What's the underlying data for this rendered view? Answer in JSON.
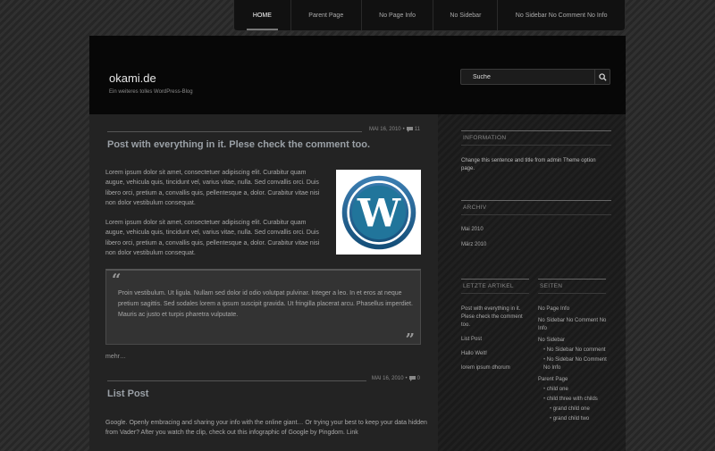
{
  "nav": {
    "home": "HOME",
    "parent_page": "Parent Page",
    "no_page_info": "No Page Info",
    "no_sidebar": "No Sidebar",
    "no_sidebar_no_comment": "No Sidebar No Comment No Info"
  },
  "header": {
    "title": "okami.de",
    "tagline": "Ein weiteres tolles WordPress-Blog"
  },
  "search": {
    "placeholder": "Suche",
    "icon": "search-icon"
  },
  "posts": [
    {
      "date": "MAI 16, 2010",
      "comments": "11",
      "title": "Post with everything in it. Plese check the comment too.",
      "paragraphs": [
        "Lorem ipsum dolor sit amet, consectetuer adipiscing elit. Curabitur quam augue, vehicula quis, tincidunt vel, varius vitae, nulla. Sed convallis orci. Duis libero orci, pretium a, convallis quis, pellentesque a, dolor. Curabitur vitae nisi non dolor vestibulum consequat.",
        "Lorem ipsum dolor sit amet, consectetuer adipiscing elit. Curabitur quam augue, vehicula quis, tincidunt vel, varius vitae, nulla. Sed convallis orci. Duis libero orci, pretium a, convallis quis, pellentesque a, dolor. Curabitur vitae nisi non dolor vestibulum consequat."
      ],
      "quote": "Proin vestibulum. Ut ligula. Nullam sed dolor id odio volutpat pulvinar. Integer a leo. In et eros at neque pretium sagittis. Sed sodales lorem a ipsum suscipit gravida. Ut fringilla placerat arcu. Phasellus imperdiet. Mauris ac justo et turpis pharetra vulputate.",
      "more": "mehr…"
    },
    {
      "date": "MAI 16, 2010",
      "comments": "0",
      "title": "List Post",
      "paragraph": "Google. Openly embracing and sharing your info with the online giant… Or trying your best to keep your data hidden from Vader? After you watch the clip, check out this infographic of Google by Pingdom. Link"
    }
  ],
  "sidebar": {
    "information": {
      "title": "INFORMATION",
      "text": "Change this sentence and title from admin Theme option page."
    },
    "archive": {
      "title": "ARCHIV",
      "items": [
        "Mai 2010",
        "März 2010"
      ]
    },
    "recent": {
      "title": "LETZTE ARTIKEL",
      "items": [
        "Post with everything in it. Plese check the comment too.",
        "List Post",
        "Hallo Welt!",
        "lorem ipsum dhorum"
      ]
    },
    "pages": {
      "title": "SEITEN",
      "items": [
        "No Page Info",
        "No Sidebar No Comment No Info",
        "No Sidebar",
        "No Sidebar No comment",
        "No Sidebar No Comment No Info",
        "Parent Page",
        "child one",
        "child three with childs",
        "grand child one",
        "grand child two"
      ]
    }
  },
  "colors": {
    "background": "#2a2a2a",
    "header": "#070707",
    "content": "#232323",
    "wp_blue": "#21759b"
  }
}
